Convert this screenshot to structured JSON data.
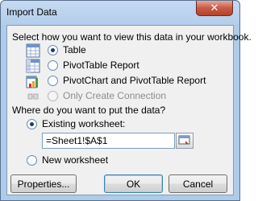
{
  "dialog": {
    "title": "Import Data",
    "close_symbol": "✕"
  },
  "view_section": {
    "prompt": "Select how you want to view this data in your workbook.",
    "options": [
      {
        "label": "Table",
        "icon": "table-icon",
        "selected": true,
        "enabled": true
      },
      {
        "label": "PivotTable Report",
        "icon": "pivottable-icon",
        "selected": false,
        "enabled": true
      },
      {
        "label": "PivotChart and PivotTable Report",
        "icon": "pivotchart-icon",
        "selected": false,
        "enabled": true
      },
      {
        "label": "Only Create Connection",
        "icon": "connection-icon",
        "selected": false,
        "enabled": false
      }
    ]
  },
  "destination_section": {
    "prompt": "Where do you want to put the data?",
    "existing_label": "Existing worksheet:",
    "existing_selected": true,
    "cell_reference": "=Sheet1!$A$1",
    "new_label": "New worksheet",
    "new_selected": false
  },
  "buttons": {
    "properties": "Properties...",
    "ok": "OK",
    "cancel": "Cancel"
  },
  "colors": {
    "frame": "#aecbea",
    "client": "#f0f0f0",
    "close": "#c75a44"
  }
}
